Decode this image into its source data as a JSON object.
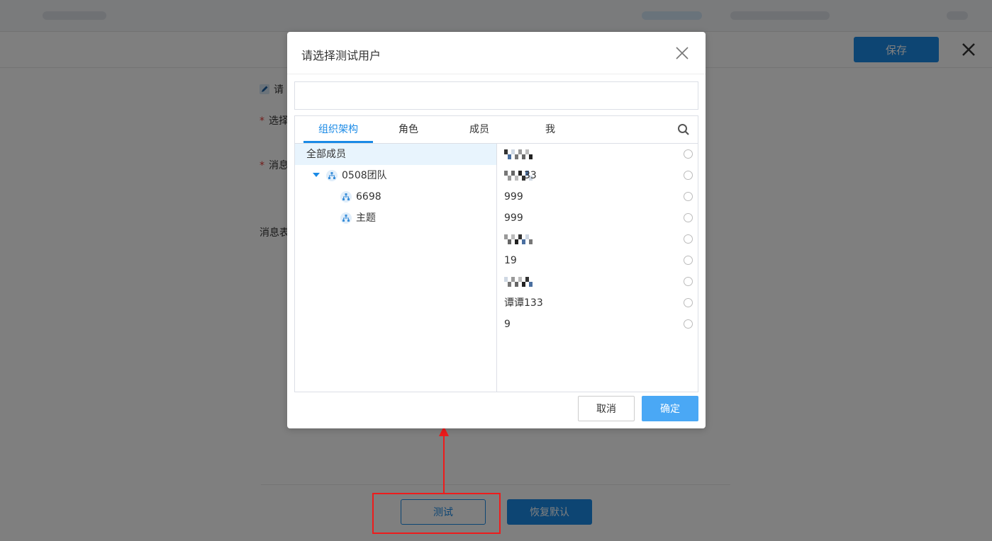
{
  "page": {
    "save_label": "保存",
    "form_note_prefix": "请",
    "form_labels": [
      "选择",
      "消息",
      "消息表"
    ],
    "test_label": "测试",
    "reset_label": "恢复默认"
  },
  "modal": {
    "title": "请选择测试用户",
    "tabs": [
      {
        "label": "组织架构",
        "active": true
      },
      {
        "label": "角色",
        "active": false
      },
      {
        "label": "成员",
        "active": false
      },
      {
        "label": "我",
        "active": false
      }
    ],
    "tree": {
      "root": "全部成员",
      "team": "0508团队",
      "children": [
        "6698",
        "主题"
      ]
    },
    "members": [
      {
        "name": "",
        "obscured": true
      },
      {
        "name": "33",
        "obscured": true
      },
      {
        "name": "999",
        "obscured": false
      },
      {
        "name": "999",
        "obscured": false
      },
      {
        "name": "",
        "obscured": true
      },
      {
        "name": "19",
        "obscured": false
      },
      {
        "name": "",
        "obscured": true
      },
      {
        "name": "谭谭133",
        "obscured": false
      },
      {
        "name": "9",
        "obscured": false
      }
    ],
    "cancel_label": "取消",
    "ok_label": "确定"
  },
  "colors": {
    "primary": "#1a8ae6",
    "ok_button": "#4aa8f5",
    "annotation": "#ee1c1c",
    "mask": "rgba(0,0,0,0.5)"
  },
  "icons": {
    "close": "close-icon",
    "search": "search-icon",
    "org": "org-tree-icon",
    "edit": "pencil-icon"
  }
}
